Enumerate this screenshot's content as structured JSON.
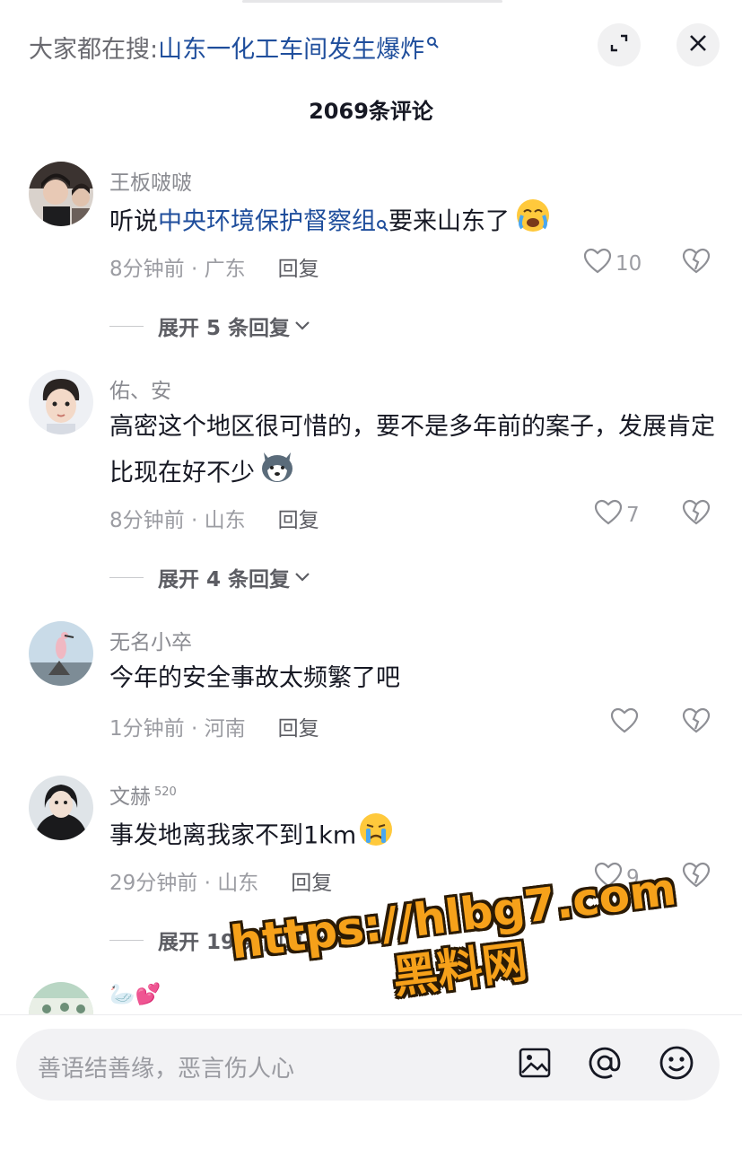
{
  "header": {
    "search_prefix": "大家都在搜:",
    "search_query": "山东一化工车间发生爆炸",
    "comment_count": "2069条评论"
  },
  "comments": [
    {
      "username": "王板啵啵",
      "text_plain": "听说",
      "text_link": "中央环境保护督察组",
      "text_after": "要来山东了",
      "time_location": "8分钟前 · 广东",
      "reply_label": "回复",
      "likes": "10",
      "expand_label": "展开 5 条回复"
    },
    {
      "username": "佑、安",
      "text": "高密这个地区很可惜的，要不是多年前的案子，发展肯定比现在好不少",
      "time_location": "8分钟前 · 山东",
      "reply_label": "回复",
      "likes": "7",
      "expand_label": "展开 4 条回复"
    },
    {
      "username": "无名小卒",
      "text": "今年的安全事故太频繁了吧",
      "time_location": "1分钟前 · 河南",
      "reply_label": "回复",
      "likes": ""
    },
    {
      "username": "文赫",
      "username_sup": "520",
      "text": "事发地离我家不到1km",
      "time_location": "29分钟前 · 山东",
      "reply_label": "回复",
      "likes": "9",
      "expand_label": "展开 19 条回复"
    },
    {
      "username": "🦢💕"
    }
  ],
  "watermark": {
    "line1": "https://hlbg7.com",
    "line2": "黑料网"
  },
  "input": {
    "placeholder": "善语结善缘，恶言伤人心"
  },
  "icons": [
    "search-icon",
    "expand-icon",
    "close-icon",
    "heart-icon",
    "broken-heart-icon",
    "chevron-down-icon",
    "image-icon",
    "at-icon",
    "emoji-icon"
  ]
}
